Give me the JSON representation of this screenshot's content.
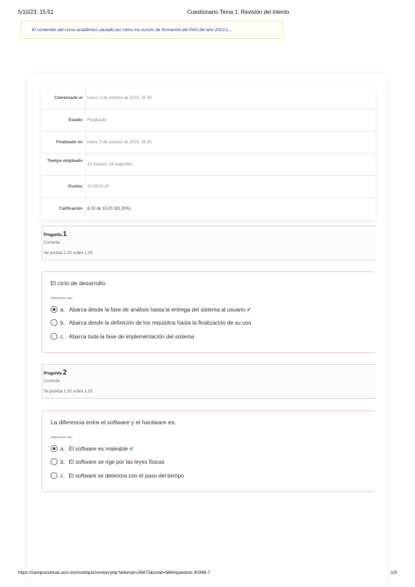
{
  "header": {
    "date": "5/10/23, 15:51",
    "title": "Cuestionario Tema 1: Revisión del intento"
  },
  "notice": "El contenido del curso académico pasado así como los cursos de formación del PAS del año 2023 s...",
  "summary": [
    {
      "label": "Comenzado el",
      "value": "lunes, 3 de octubre de 2023, 15:30"
    },
    {
      "label": "Estado",
      "value": "Finalizado"
    },
    {
      "label": "Finalizado en",
      "value": "lunes, 3 de octubre de 2023, 15:30"
    },
    {
      "label": "Tiempo empleado",
      "value": "10 minutos 34 segundos"
    },
    {
      "label": "Puntos",
      "value": "10,00/12,00"
    },
    {
      "label": "Calificación",
      "value": "8,33 de 10,00 (83,33%)"
    }
  ],
  "questions": [
    {
      "label": "Pregunta",
      "number": "1",
      "state": "Correcta",
      "grade": "Se puntúa 1,00 sobre 1,00",
      "prompt": "El ciclo de desarrollo:",
      "choose": "Seleccione una:",
      "options": [
        {
          "letter": "a.",
          "text": "Abarca desde la fase de análisis hasta la entrega del sistema al usuario",
          "selected": true,
          "correct": true
        },
        {
          "letter": "b.",
          "text": "Abarca desde la definición de los requisitos hasta la finalización de su uso",
          "selected": false,
          "correct": false
        },
        {
          "letter": "c.",
          "text": "Abarca toda la fase de implementación del sistema",
          "selected": false,
          "correct": false
        }
      ]
    },
    {
      "label": "Pregunta",
      "number": "2",
      "state": "Correcta",
      "grade": "Se puntúa 1,00 sobre 1,00",
      "prompt": "La diferencia entre el software y el hardware es:",
      "choose": "Seleccione una:",
      "options": [
        {
          "letter": "a.",
          "text": "El software es maleable",
          "selected": true,
          "correct": true
        },
        {
          "letter": "b.",
          "text": "El software se rige por las leyes físicas",
          "selected": false,
          "correct": false
        },
        {
          "letter": "c.",
          "text": "El software se deteriora con el paso del tiempo",
          "selected": false,
          "correct": false
        }
      ]
    }
  ],
  "footer": {
    "url": "https://campusvirtual.ucm.es/mod/quiz/review.php?attempt=26873&cmid=566#question-30388-7",
    "page": "1/5"
  },
  "colors": {
    "correct_check": "#3aa857",
    "link": "#1d3e8a",
    "question_border": "#f0c8c8"
  }
}
